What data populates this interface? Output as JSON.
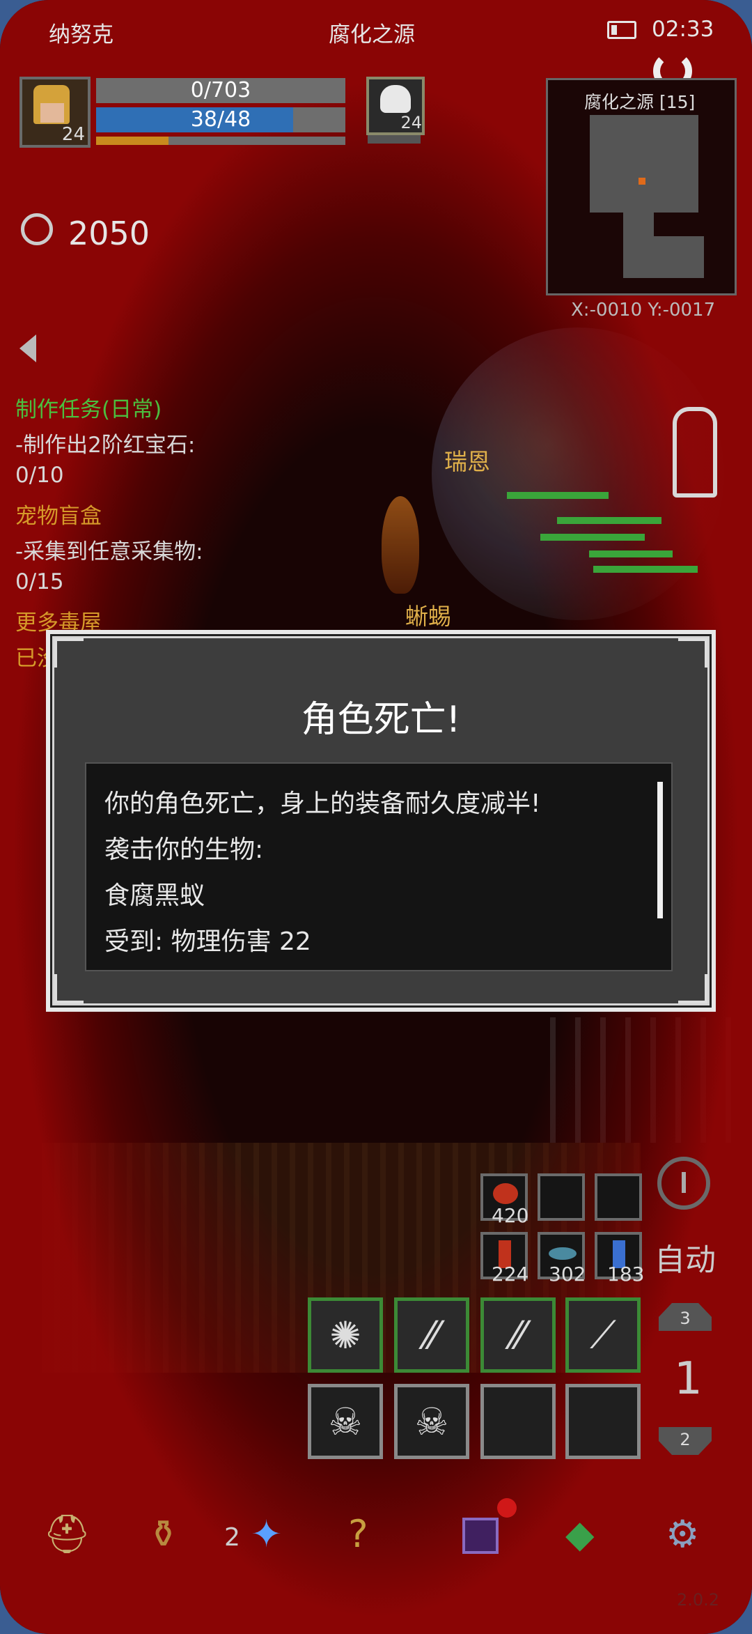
{
  "status_bar": {
    "left_text": "纳努克",
    "center_text": "腐化之源",
    "time": "02:33"
  },
  "player": {
    "level": "24",
    "hp": "0/703",
    "mp": "38/48",
    "hp_fill": 0.0,
    "mp_fill": 0.79,
    "exp_fill": 0.29
  },
  "target": {
    "level": "24"
  },
  "minimap": {
    "title": "腐化之源 [15]",
    "coords": "X:-0010  Y:-0017"
  },
  "timer": {
    "value": "2050"
  },
  "quests": [
    {
      "text": "制作任务(日常)",
      "color": "#4bbf3f"
    },
    {
      "text": "-制作出2阶红宝石:",
      "color": "#d8d8d8"
    },
    {
      "text": "0/10",
      "color": "#d8d8d8"
    },
    {
      "text": "宠物盲盒",
      "color": "#d69a2a"
    },
    {
      "text": "-采集到任意采集物:",
      "color": "#d8d8d8"
    },
    {
      "text": "0/15",
      "color": "#d8d8d8"
    },
    {
      "text": "更多毒屋",
      "color": "#d69a2a"
    },
    {
      "text": "已没",
      "color": "#d69a2a"
    }
  ],
  "world_labels": {
    "npc1": "瑞恩",
    "npc2": "蜥蜴"
  },
  "dialog": {
    "title": "角色死亡!",
    "lines": [
      "你的角色死亡，身上的装备耐久度减半!",
      "袭击你的生物:",
      "食腐黑蚁",
      "受到: 物理伤害 22"
    ]
  },
  "items": {
    "slot1_count": "420",
    "slot4_count": "224",
    "slot5_count": "302",
    "slot6_count": "183"
  },
  "controls": {
    "auto_label": "自动",
    "page_up": "3",
    "page_current": "1",
    "page_down": "2"
  },
  "bottom_bar": {
    "badge_count": "2"
  },
  "version": "2.0.2",
  "colors": {
    "hp_fill": "#b02020",
    "mp_fill": "#2f6fb5",
    "exp_fill": "#c98a1e",
    "quest_green": "#4bbf3f",
    "quest_orange": "#d69a2a"
  }
}
